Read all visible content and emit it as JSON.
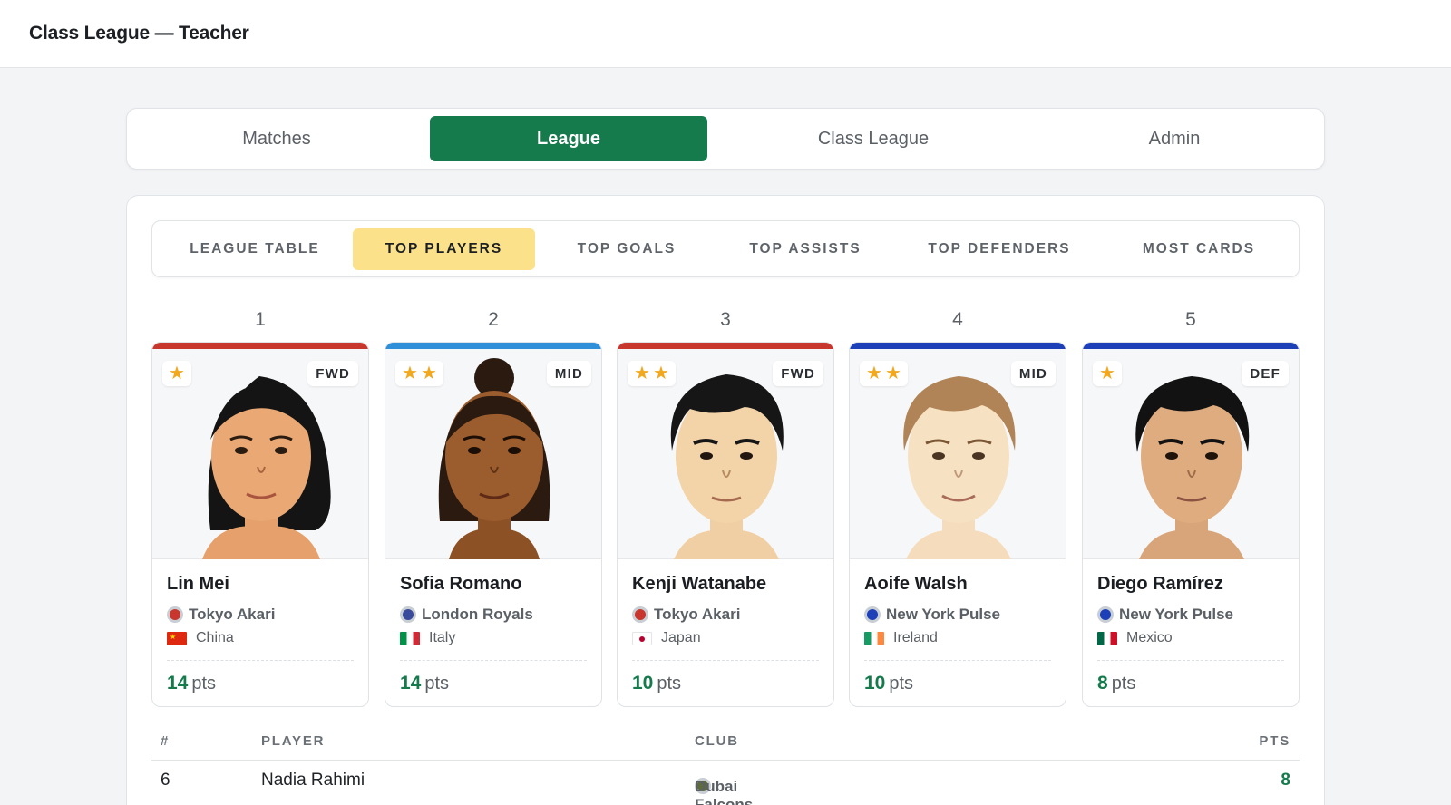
{
  "app": {
    "title": "Class League — Teacher"
  },
  "nav": {
    "tabs": [
      {
        "label": "Matches"
      },
      {
        "label": "League"
      },
      {
        "label": "Class League"
      },
      {
        "label": "Admin"
      }
    ],
    "active": "League"
  },
  "subnav": {
    "tabs": [
      {
        "label": "LEAGUE TABLE"
      },
      {
        "label": "TOP PLAYERS"
      },
      {
        "label": "TOP GOALS"
      },
      {
        "label": "TOP ASSISTS"
      },
      {
        "label": "TOP DEFENDERS"
      },
      {
        "label": "MOST CARDS"
      }
    ],
    "active": "TOP PLAYERS"
  },
  "colors": {
    "primary": "#157a4c",
    "highlight": "#fbe28a",
    "star": "#f2a81d"
  },
  "players": [
    {
      "rank": "1",
      "name": "Lin Mei",
      "position": "FWD",
      "stars": 1,
      "club": "Tokyo Akari",
      "country": "China",
      "points": "14",
      "points_unit": "pts",
      "accent": "#c8372d"
    },
    {
      "rank": "2",
      "name": "Sofia Romano",
      "position": "MID",
      "stars": 2,
      "club": "London Royals",
      "country": "Italy",
      "points": "14",
      "points_unit": "pts",
      "accent": "#2f8fd8"
    },
    {
      "rank": "3",
      "name": "Kenji Watanabe",
      "position": "FWD",
      "stars": 2,
      "club": "Tokyo Akari",
      "country": "Japan",
      "points": "10",
      "points_unit": "pts",
      "accent": "#c8372d"
    },
    {
      "rank": "4",
      "name": "Aoife Walsh",
      "position": "MID",
      "stars": 2,
      "club": "New York Pulse",
      "country": "Ireland",
      "points": "10",
      "points_unit": "pts",
      "accent": "#1d3fb8"
    },
    {
      "rank": "5",
      "name": "Diego Ramírez",
      "position": "DEF",
      "stars": 1,
      "club": "New York Pulse",
      "country": "Mexico",
      "points": "8",
      "points_unit": "pts",
      "accent": "#1d3fb8"
    }
  ],
  "table": {
    "headers": {
      "rank": "#",
      "player": "PLAYER",
      "club": "CLUB",
      "pts": "PTS"
    },
    "rows": [
      {
        "rank": "6",
        "player": "Nadia Rahimi",
        "club": "Dubai Falcons",
        "pts": "8"
      }
    ]
  }
}
